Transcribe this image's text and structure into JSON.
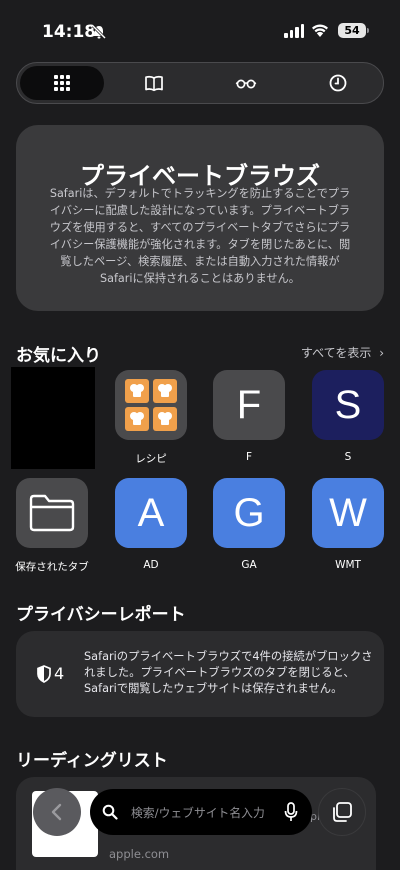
{
  "status_bar": {
    "time": "14:18",
    "battery": "54"
  },
  "tabs": [
    "tab-groups",
    "bookmarks",
    "reading-list",
    "history"
  ],
  "private_browsing": {
    "title": "プライベートブラウズ",
    "body": "Safariは、デフォルトでトラッキングを防止することでプライバシーに配慮した設計になっています。プライベートブラウズを使用すると、すべてのプライベートタブでさらにプライバシー保護機能が強化されます。タブを閉じたあとに、閲覧したページ、検索履歴、または自動入力された情報がSafariに保持されることはありません。"
  },
  "favorites": {
    "title": "お気に入り",
    "show_all": "すべてを表示",
    "items": [
      {
        "label": "レシピ",
        "icon": "recipes-folder-icon",
        "color": "#4a4a4c"
      },
      {
        "label": "F",
        "tile": "F",
        "color": "#4a4a4c"
      },
      {
        "label": "S",
        "tile": "S",
        "color": "#1c1f5e"
      },
      {
        "label": "保存されたタブ",
        "icon": "folder-icon",
        "color": "#4a4a4c"
      },
      {
        "label": "AD",
        "tile": "A",
        "color": "#4a7fe0"
      },
      {
        "label": "GA",
        "tile": "G",
        "color": "#4a7fe0"
      },
      {
        "label": "WMT",
        "tile": "W",
        "color": "#4a7fe0"
      }
    ]
  },
  "privacy_report": {
    "title": "プライバシーレポート",
    "count": "4",
    "text": "Safariのプライベートブラウズで4件の接続がブロックされました。プライベートブラウズのタブを閉じると、Safariで閲覧したウェブサイトは保存されません。"
  },
  "reading_list": {
    "title": "リーディングリスト",
    "item": {
      "domain": "apple.com",
      "fragment": "pl"
    }
  },
  "search": {
    "placeholder": "検索/ウェブサイト名入力"
  },
  "colors": {
    "background": "#1c1c1e",
    "card": "#2c2c2e",
    "accent_blue": "#4a7fe0"
  }
}
